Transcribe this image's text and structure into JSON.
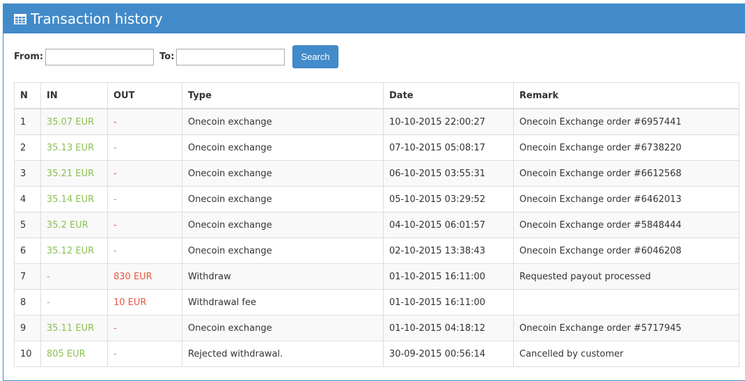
{
  "title": "Transaction history",
  "form": {
    "from_label": "From:",
    "to_label": "To:",
    "from_value": "",
    "to_value": "",
    "search": "Search"
  },
  "columns": [
    "N",
    "IN",
    "OUT",
    "Type",
    "Date",
    "Remark"
  ],
  "rows": [
    [
      "1",
      "35.07 EUR",
      "-",
      "Onecoin exchange",
      "10-10-2015 22:00:27",
      "Onecoin Exchange order #6957441"
    ],
    [
      "2",
      "35.13 EUR",
      "-",
      "Onecoin exchange",
      "07-10-2015 05:08:17",
      "Onecoin Exchange order #6738220"
    ],
    [
      "3",
      "35.21 EUR",
      "-",
      "Onecoin exchange",
      "06-10-2015 03:55:31",
      "Onecoin Exchange order #6612568"
    ],
    [
      "4",
      "35.14 EUR",
      "-",
      "Onecoin exchange",
      "05-10-2015 03:29:52",
      "Onecoin Exchange order #6462013"
    ],
    [
      "5",
      "35.2 EUR",
      "-",
      "Onecoin exchange",
      "04-10-2015 06:01:57",
      "Onecoin Exchange order #5848444"
    ],
    [
      "6",
      "35.12 EUR",
      "-",
      "Onecoin exchange",
      "02-10-2015 13:38:43",
      "Onecoin Exchange order #6046208"
    ],
    [
      "7",
      "-",
      "830 EUR",
      "Withdraw",
      "01-10-2015 16:11:00",
      "Requested payout processed"
    ],
    [
      "8",
      "-",
      "10 EUR",
      "Withdrawal fee",
      "01-10-2015 16:11:00",
      ""
    ],
    [
      "9",
      "35.11 EUR",
      "-",
      "Onecoin exchange",
      "01-10-2015 04:18:12",
      "Onecoin Exchange order #5717945"
    ],
    [
      "10",
      "805 EUR",
      "-",
      "Rejected withdrawal.",
      "30-09-2015 00:56:14",
      "Cancelled by customer"
    ]
  ]
}
